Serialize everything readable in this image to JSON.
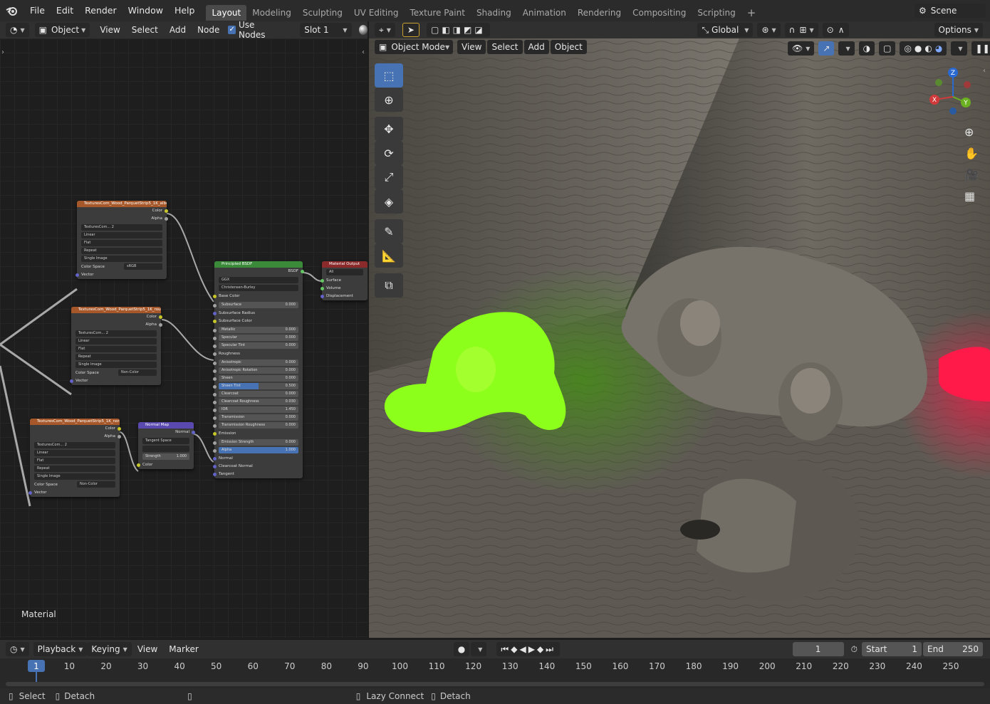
{
  "menus": [
    "File",
    "Edit",
    "Render",
    "Window",
    "Help"
  ],
  "workspaces": [
    "Layout",
    "Modeling",
    "Sculpting",
    "UV Editing",
    "Texture Paint",
    "Shading",
    "Animation",
    "Rendering",
    "Compositing",
    "Scripting"
  ],
  "active_workspace": "Layout",
  "scene_label": "Scene",
  "node_header": {
    "object_dropdown": "Object",
    "view": "View",
    "select": "Select",
    "add": "Add",
    "node": "Node",
    "use_nodes": "Use Nodes",
    "slot": "Slot 1"
  },
  "viewport_header": {
    "orientation": "Global",
    "options": "Options",
    "mode": "Object Mode",
    "view": "View",
    "select": "Select",
    "add": "Add",
    "object": "Object"
  },
  "material_label": "Material",
  "nodes": {
    "tex1": {
      "title": "TexturesCom_Wood_ParquetStrip5_1K_albe",
      "out_color": "Color",
      "out_alpha": "Alpha",
      "image_name": "TexturesCom...",
      "users": "2",
      "interp": "Linear",
      "proj": "Flat",
      "ext": "Repeat",
      "source": "Single Image",
      "cs_label": "Color Space",
      "cs_value": "sRGB",
      "vector": "Vector"
    },
    "tex2": {
      "title": "TexturesCom_Wood_ParquetStrip5_1K_roug",
      "out_color": "Color",
      "out_alpha": "Alpha",
      "image_name": "TexturesCom...",
      "users": "2",
      "interp": "Linear",
      "proj": "Flat",
      "ext": "Repeat",
      "source": "Single Image",
      "cs_label": "Color Space",
      "cs_value": "Non-Color",
      "vector": "Vector"
    },
    "tex3": {
      "title": "TexturesCom_Wood_ParquetStrip5_1K_nor...",
      "out_color": "Color",
      "out_alpha": "Alpha",
      "image_name": "TexturesCom...",
      "users": "2",
      "interp": "Linear",
      "proj": "Flat",
      "ext": "Repeat",
      "source": "Single Image",
      "cs_label": "Color Space",
      "cs_value": "Non-Color",
      "vector": "Vector"
    },
    "normal_map": {
      "title": "Normal Map",
      "out": "Normal",
      "space": "Tangent Space",
      "strength_label": "Strength",
      "strength": "1.000",
      "color": "Color"
    },
    "bsdf": {
      "title": "Principled BSDF",
      "out": "BSDF",
      "dist": "GGX",
      "sss": "Christensen-Burley",
      "base_color": "Base Color",
      "fields": [
        {
          "label": "Subsurface",
          "value": "0.000"
        },
        {
          "label": "Subsurface Radius",
          "value": ""
        },
        {
          "label": "Subsurface Color",
          "value": ""
        },
        {
          "label": "Metallic",
          "value": "0.000"
        },
        {
          "label": "Specular",
          "value": "0.000"
        },
        {
          "label": "Specular Tint",
          "value": "0.000"
        },
        {
          "label": "Roughness",
          "value": ""
        },
        {
          "label": "Anisotropic",
          "value": "0.000"
        },
        {
          "label": "Anisotropic Rotation",
          "value": "0.000"
        },
        {
          "label": "Sheen",
          "value": "0.000"
        },
        {
          "label": "Sheen Tint",
          "value": "0.500"
        },
        {
          "label": "Clearcoat",
          "value": "0.000"
        },
        {
          "label": "Clearcoat Roughness",
          "value": "0.030"
        },
        {
          "label": "IOR",
          "value": "1.450"
        },
        {
          "label": "Transmission",
          "value": "0.000"
        },
        {
          "label": "Transmission Roughness",
          "value": "0.000"
        },
        {
          "label": "Emission",
          "value": ""
        },
        {
          "label": "Emission Strength",
          "value": "0.000"
        },
        {
          "label": "Alpha",
          "value": "1.000"
        },
        {
          "label": "Normal",
          "value": ""
        },
        {
          "label": "Clearcoat Normal",
          "value": ""
        },
        {
          "label": "Tangent",
          "value": ""
        }
      ]
    },
    "output": {
      "title": "Material Output",
      "target": "All",
      "surface": "Surface",
      "volume": "Volume",
      "displacement": "Displacement"
    }
  },
  "timeline": {
    "playback": "Playback",
    "keying": "Keying",
    "view": "View",
    "marker": "Marker",
    "current_frame": "1",
    "start_label": "Start",
    "start": "1",
    "end_label": "End",
    "end": "250",
    "ticks": [
      "1",
      "10",
      "20",
      "30",
      "40",
      "50",
      "60",
      "70",
      "80",
      "90",
      "100",
      "110",
      "120",
      "130",
      "140",
      "150",
      "160",
      "170",
      "180",
      "190",
      "200",
      "210",
      "220",
      "230",
      "240",
      "250"
    ]
  },
  "status": {
    "select": "Select",
    "detach1": "Detach",
    "lazy_connect": "Lazy Connect",
    "detach2": "Detach"
  },
  "colors": {
    "accent": "#4772b3",
    "green_monkey": "#8cff1a",
    "red_light": "#ff1a4a"
  }
}
